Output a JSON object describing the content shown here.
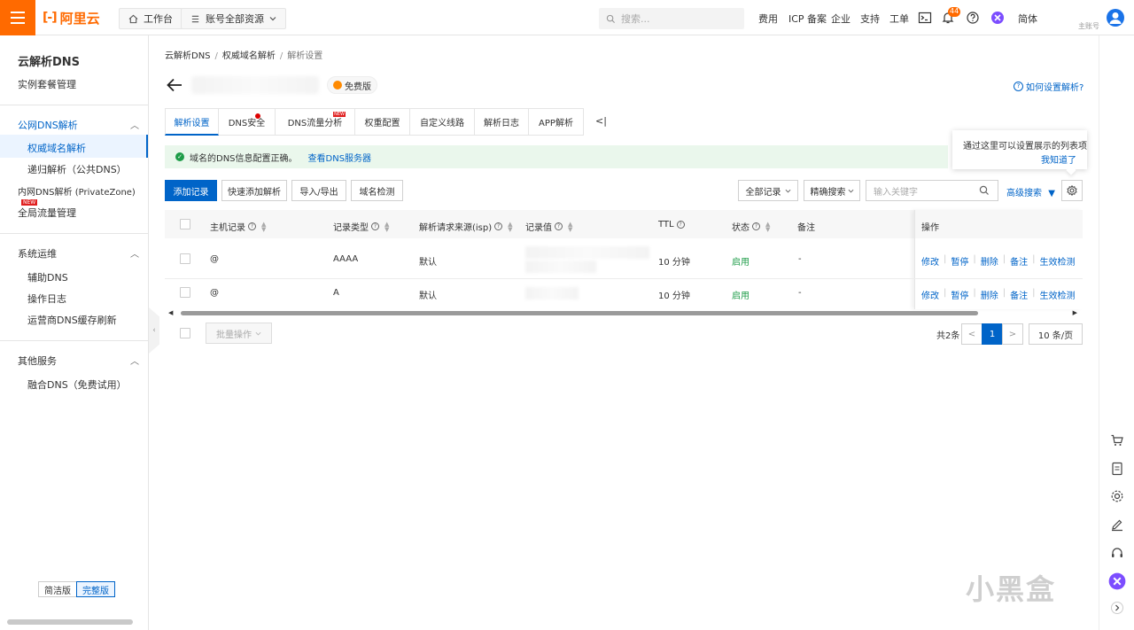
{
  "topbar": {
    "logo_text": "阿里云",
    "workbench": "工作台",
    "resources": "账号全部资源",
    "search_placeholder": "搜索...",
    "nav": [
      "费用",
      "ICP 备案",
      "企业",
      "支持",
      "工单"
    ],
    "notification_count": "44",
    "language": "简体",
    "account_label": "主账号"
  },
  "sidebar": {
    "title": "云解析DNS",
    "instance": "实例套餐管理",
    "public_dns": "公网DNS解析",
    "authoritative": "权威域名解析",
    "recursive": "递归解析（公共DNS）",
    "private_zone": "内网DNS解析 (PrivateZone)",
    "new_tag": "NEW",
    "global_traffic": "全局流量管理",
    "ops_group": "系统运维",
    "aux_dns": "辅助DNS",
    "op_log": "操作日志",
    "isp_cache": "运营商DNS缓存刷新",
    "other_group": "其他服务",
    "fusion_dns": "融合DNS（免费试用）",
    "mode_simple": "简洁版",
    "mode_full": "完整版"
  },
  "breadcrumb": {
    "items": [
      "云解析DNS",
      "权威域名解析",
      "解析设置"
    ]
  },
  "header": {
    "plan_tag": "免费版",
    "help_link": "如何设置解析?"
  },
  "tabs": [
    {
      "label": "解析设置"
    },
    {
      "label": "DNS安全"
    },
    {
      "label": "DNS流量分析"
    },
    {
      "label": "权重配置"
    },
    {
      "label": "自定义线路"
    },
    {
      "label": "解析日志"
    },
    {
      "label": "APP解析"
    }
  ],
  "tab_new_tag": "NEW",
  "tab_more": "<|",
  "notice": {
    "text": "域名的DNS信息配置正确。",
    "link": "查看DNS服务器"
  },
  "popover": {
    "text": "通过这里可以设置展示的列表项",
    "ack": "我知道了"
  },
  "toolbar": {
    "add": "添加记录",
    "quick_add": "快速添加解析",
    "import_export": "导入/导出",
    "domain_check": "域名检测",
    "all_records": "全部记录",
    "precise_search": "精确搜索",
    "keyword_placeholder": "输入关键字",
    "advanced_search": "高级搜索"
  },
  "table": {
    "columns": [
      "主机记录",
      "记录类型",
      "解析请求来源(isp)",
      "记录值",
      "TTL",
      "状态",
      "备注",
      "操作"
    ],
    "rows": [
      {
        "host": "@",
        "type": "AAAA",
        "isp": "默认",
        "ttl": "10 分钟",
        "status": "启用",
        "remark": "-"
      },
      {
        "host": "@",
        "type": "A",
        "isp": "默认",
        "ttl": "10 分钟",
        "status": "启用",
        "remark": "-"
      }
    ],
    "actions": [
      "修改",
      "暂停",
      "删除",
      "备注",
      "生效检测"
    ]
  },
  "footer": {
    "bulk": "批量操作",
    "total": "共2条",
    "prev": "<",
    "page": "1",
    "next": ">",
    "page_size": "10 条/页"
  },
  "watermark": "小黑盒",
  "colors": {
    "brand": "#ff6a00",
    "primary": "#0064c8",
    "success": "#1e9c48"
  }
}
